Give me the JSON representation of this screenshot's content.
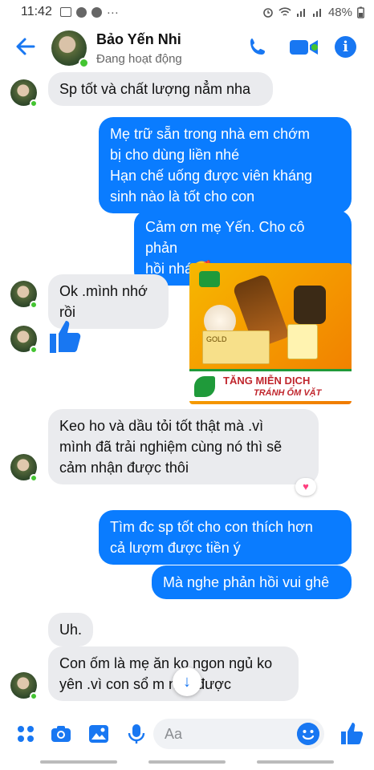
{
  "status_bar": {
    "time": "11:42",
    "battery": "48%"
  },
  "header": {
    "name": "Bảo Yến Nhi",
    "status": "Đang hoạt động"
  },
  "messages": {
    "m1": "Sp tốt và chất lượng nẳm nha",
    "m2": "Mẹ trữ sẵn trong nhà em chớm\nbị cho dùng liền nhé\nHạn chế uống được viên kháng\nsinh nào là tốt cho con",
    "m3": "Cảm ơn mẹ Yến. Cho cô phản\nhồi nhá🥰",
    "m4": "Ok .mình nhớ rồi",
    "m5": "Keo ho và dầu tỏi tốt thật mà .vì\nmình đã trải nghiệm cùng nó thì sẽ\ncảm nhận được thôi",
    "m6": "Tìm đc sp tốt cho con thích hơn\ncả lượm được tiền ý",
    "m7": "Mà nghe phản hồi vui ghê",
    "m8": "Uh.",
    "m9": "Con ốm là mẹ ăn ko ngon ngủ ko\nyên .vì con sổ m     ngủ được"
  },
  "ad_image": {
    "banner_line1": "TĂNG MIỄN DỊCH",
    "banner_line2": "TRÁNH ỐM VẶT",
    "box_label": "GOLD"
  },
  "composer": {
    "placeholder": "Aa"
  },
  "colors": {
    "accent": "#1877f2",
    "outgoing_bubble": "#0a7cff",
    "incoming_bubble": "#eaebee",
    "online": "#43c431"
  },
  "icons": [
    "back-arrow-icon",
    "phone-icon",
    "video-camera-icon",
    "info-icon",
    "thumbs-up-icon",
    "heart-reaction-icon",
    "arrow-down-icon",
    "menu-dots-icon",
    "camera-icon",
    "gallery-icon",
    "microphone-icon",
    "emoji-icon"
  ]
}
